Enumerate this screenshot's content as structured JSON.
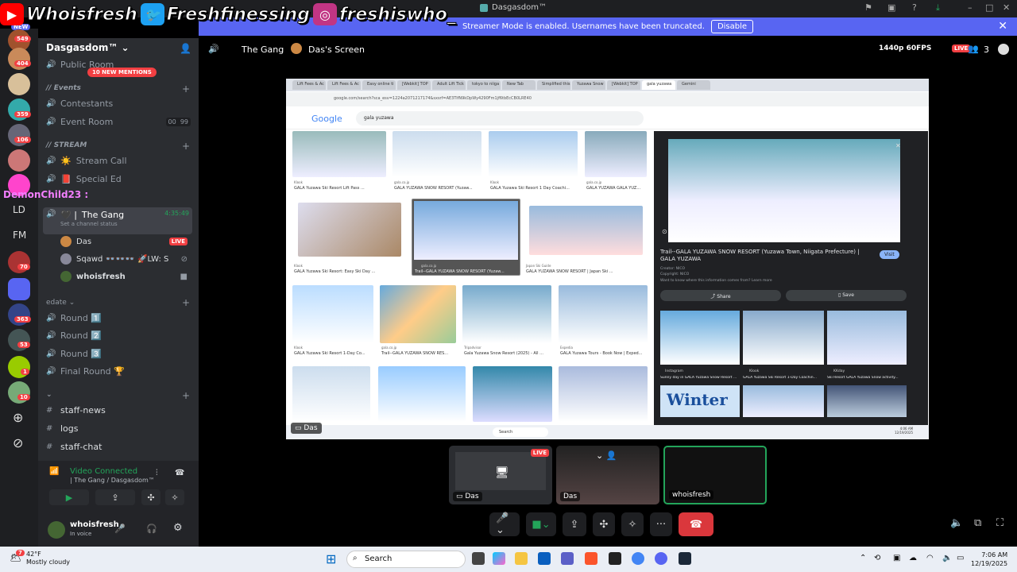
{
  "window": {
    "title": "Dasgasdom™",
    "icons": [
      "pin-icon",
      "inbox-icon",
      "help-icon",
      "download-icon"
    ]
  },
  "overlay": {
    "handles": [
      {
        "icon": "youtube-icon",
        "text": "Whoisfresh",
        "color": "#ff0000"
      },
      {
        "icon": "twitter-icon",
        "text": "Freshfinessing",
        "color": "#1da1f2"
      },
      {
        "icon": "instagram-icon",
        "text": "freshiswho_",
        "color": "#c13584"
      }
    ]
  },
  "streamer_banner": {
    "text": "Streamer Mode is enabled. Usernames have been truncated.",
    "button": "Disable"
  },
  "rail": {
    "badges": [
      "549",
      "404",
      "359",
      "106",
      "70",
      "363",
      "53",
      "1",
      "10"
    ],
    "labels": [
      "LD",
      "FM"
    ],
    "status_badge": "NEW"
  },
  "sidebar": {
    "guild": "Dasgasdom™",
    "public_room": "Public Room",
    "mentions": "10 NEW MENTIONS",
    "events_cat": "// Events",
    "contestants": "Contestants",
    "event_room": "Event Room",
    "event_room_count": "00",
    "event_room_limit": "99",
    "stream_cat": "// STREAM",
    "stream_call": "Stream Call",
    "special_ed": "Special Ed",
    "chat_user": "DemonChild23 :",
    "the_gang": "The Gang",
    "the_gang_timer": "4:35:49",
    "channel_status": "Set a channel status",
    "members": [
      {
        "name": "Das",
        "live": "LIVE"
      },
      {
        "name": "Sqawd 👓👓👓 🚀LW: S"
      },
      {
        "name": "whoisfresh"
      }
    ],
    "edate_cat": "edate",
    "rounds": [
      "Round 1️⃣",
      "Round 2️⃣",
      "Round 3️⃣",
      "Final Round 🏆"
    ],
    "staff": [
      "staff-news",
      "logs",
      "staff-chat"
    ],
    "voice_connected": "Video Connected",
    "voice_channel": "| The Gang / Dasgasdom™",
    "username": "whoisfresh",
    "user_status": "In voice"
  },
  "call": {
    "channel": "The Gang",
    "screen_label": "Das's Screen",
    "quality": "1440p 60FPS",
    "live": "LIVE",
    "viewers": "3",
    "stream_name": "Das"
  },
  "browser": {
    "tabs": [
      "Lift Fees & Ac",
      "Lift Fees & Ac",
      "Easy online ti",
      "[Webkit] TOP",
      "Adult Lift Tick",
      "tokyo to niiga",
      "New Tab",
      "Simplified this",
      "Yuzawa Snow",
      "[Webkit] TOP",
      "gala yuzawa",
      "Gemini"
    ],
    "url": "google.com/search?sca_esv=1224a2071217174&sxsrf=AE3TifN9kDpWy4290Fm1jf6tbEcCB0LRE40",
    "logo": "Google",
    "query": "gala yuzawa",
    "results": [
      {
        "src": "Klook",
        "cap": "GALA Yuzawa Ski Resort Lift Pass ..."
      },
      {
        "src": "gala.co.jp",
        "cap": "GALA YUZAWA SNOW RESORT (Yuzaw..."
      },
      {
        "src": "Klook",
        "cap": "GALA Yuzawa Ski Resort 1 Day Coachi..."
      },
      {
        "src": "gala.co.jp",
        "cap": "GALA YUZAWA GALA YUZ..."
      },
      {
        "src": "Klook",
        "cap": "GALA Yuzawa Ski Resort: Easy Ski Day ..."
      },
      {
        "src": "gala.co.jp",
        "cap": "Trail--GALA YUZAWA SNOW RESORT (Yuzaw..."
      },
      {
        "src": "Japan Ski Guide",
        "cap": "GALA YUZAWA SNOW RESORT | Japan Ski ..."
      },
      {
        "src": "Klook",
        "cap": "GALA Yuzawa Ski Resort 1-Day Co..."
      },
      {
        "src": "gala.co.jp",
        "cap": "Trail--GALA YUZAWA SNOW RES..."
      },
      {
        "src": "Tripadvisor",
        "cap": "Gala Yuzawa Snow Resort (2025) - All ..."
      },
      {
        "src": "Expedia",
        "cap": "GALA Yuzawa Tours - Book Now | Exped..."
      }
    ],
    "preview": {
      "title": "Trail--GALA YUZAWA SNOW RESORT (Yuzawa Town, Niigata Prefecture) | GALA YUZAWA",
      "visit": "Visit",
      "creator": "Creator: NICO",
      "copyright": "Copyright: NICO",
      "want": "Want to know where this information comes from? Learn more",
      "share": "Share",
      "save": "Save",
      "rel": [
        "Instagram",
        "Klook",
        "KKday"
      ],
      "relcap": [
        "Sunny day in GALA Yuzawa Snow Resort ...",
        "GALA Yuzawa Ski Resort 1-Day Coachin...",
        "Ski Resort GALA Yuzawa Snow activity..."
      ],
      "banner": "Winter"
    },
    "taskbar": {
      "search": "Search",
      "time": "4:06 AM",
      "date": "12/19/2025"
    }
  },
  "tiles": [
    {
      "name": "Das",
      "live": "LIVE"
    },
    {
      "name": "Das"
    },
    {
      "name": "whoisfresh"
    }
  ],
  "os": {
    "temp": "42°F",
    "weather": "Mostly cloudy",
    "weather_badge": "7",
    "search": "Search",
    "time": "7:06 AM",
    "date": "12/19/2025"
  }
}
